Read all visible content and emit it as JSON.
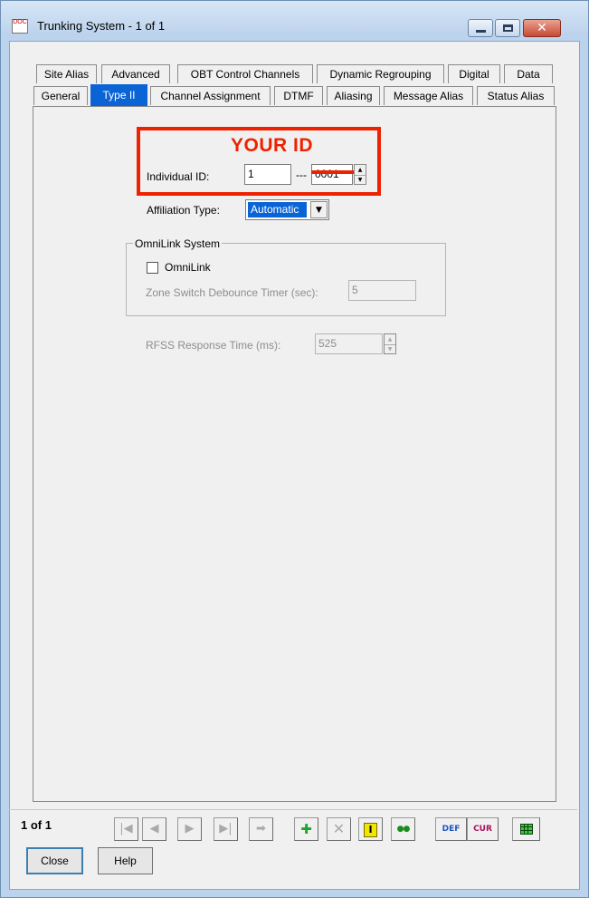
{
  "window": {
    "title": "Trunking System - 1 of 1",
    "icon": "app-document-icon",
    "icon_text": "DOC",
    "buttons": {
      "minimize": "minimize-icon",
      "maximize": "maximize-icon",
      "close": "✕"
    }
  },
  "tabs": {
    "row1": [
      "Site Alias",
      "Advanced",
      "OBT Control Channels",
      "Dynamic Regrouping",
      "Digital",
      "Data"
    ],
    "row2": [
      "General",
      "Type II",
      "Channel Assignment",
      "DTMF",
      "Aliasing",
      "Message Alias",
      "Status Alias"
    ],
    "active": "Type II"
  },
  "annotation": {
    "text": "YOUR ID",
    "color": "#ee2200"
  },
  "type2": {
    "individual_id_label": "Individual ID:",
    "individual_id_value": "1",
    "separator": "---",
    "id_suffix_value": "0001",
    "affiliation_label": "Affiliation Type:",
    "affiliation_value": "Automatic",
    "omnilink": {
      "group_title": "OmniLink System",
      "checkbox_label": "OmniLink",
      "checked": false,
      "debounce_label": "Zone Switch Debounce Timer (sec):",
      "debounce_value": "5"
    },
    "rfss_label": "RFSS Response Time (ms):",
    "rfss_value": "525"
  },
  "footer": {
    "record_count": "1 of 1",
    "nav_glyphs": {
      "first": "|◀",
      "prev": "◀",
      "next": "▶",
      "last": "▶|",
      "goto": "➡"
    },
    "tool_glyphs": {
      "add": "✚",
      "delete": "✕",
      "insert": "I",
      "copy": "●●",
      "def": "DEF",
      "cur": "CUR"
    },
    "close_label": "Close",
    "help_label": "Help"
  },
  "colors": {
    "active_tab": "#0a64d6",
    "annotation_red": "#ee2200",
    "add_green": "#1fa52b"
  }
}
